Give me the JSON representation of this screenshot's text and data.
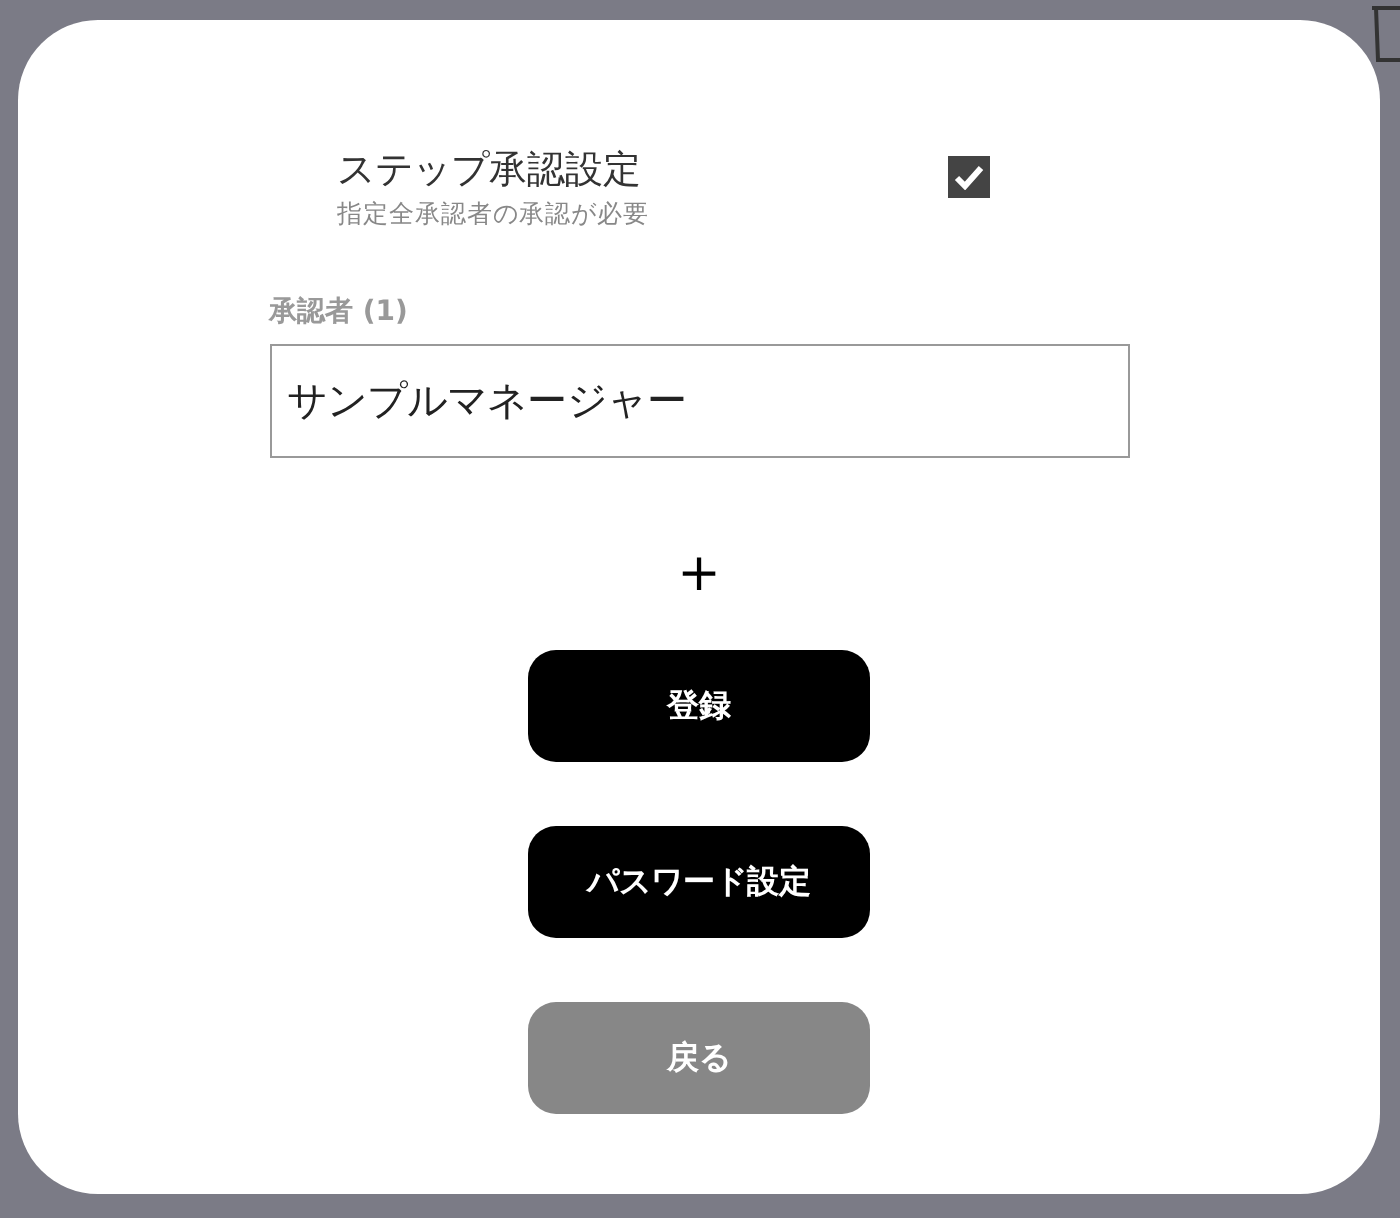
{
  "step_approval": {
    "title": "ステップ承認設定",
    "description": "指定全承認者の承認が必要",
    "checked": true
  },
  "approvers": {
    "label": "承認者 (1)",
    "fields": [
      {
        "value": "サンプルマネージャー"
      }
    ]
  },
  "add_button": {
    "label": "+"
  },
  "buttons": [
    {
      "label": "登録",
      "kind": "primary"
    },
    {
      "label": "パスワード設定",
      "kind": "primary"
    },
    {
      "label": "戻る",
      "kind": "secondary"
    }
  ]
}
